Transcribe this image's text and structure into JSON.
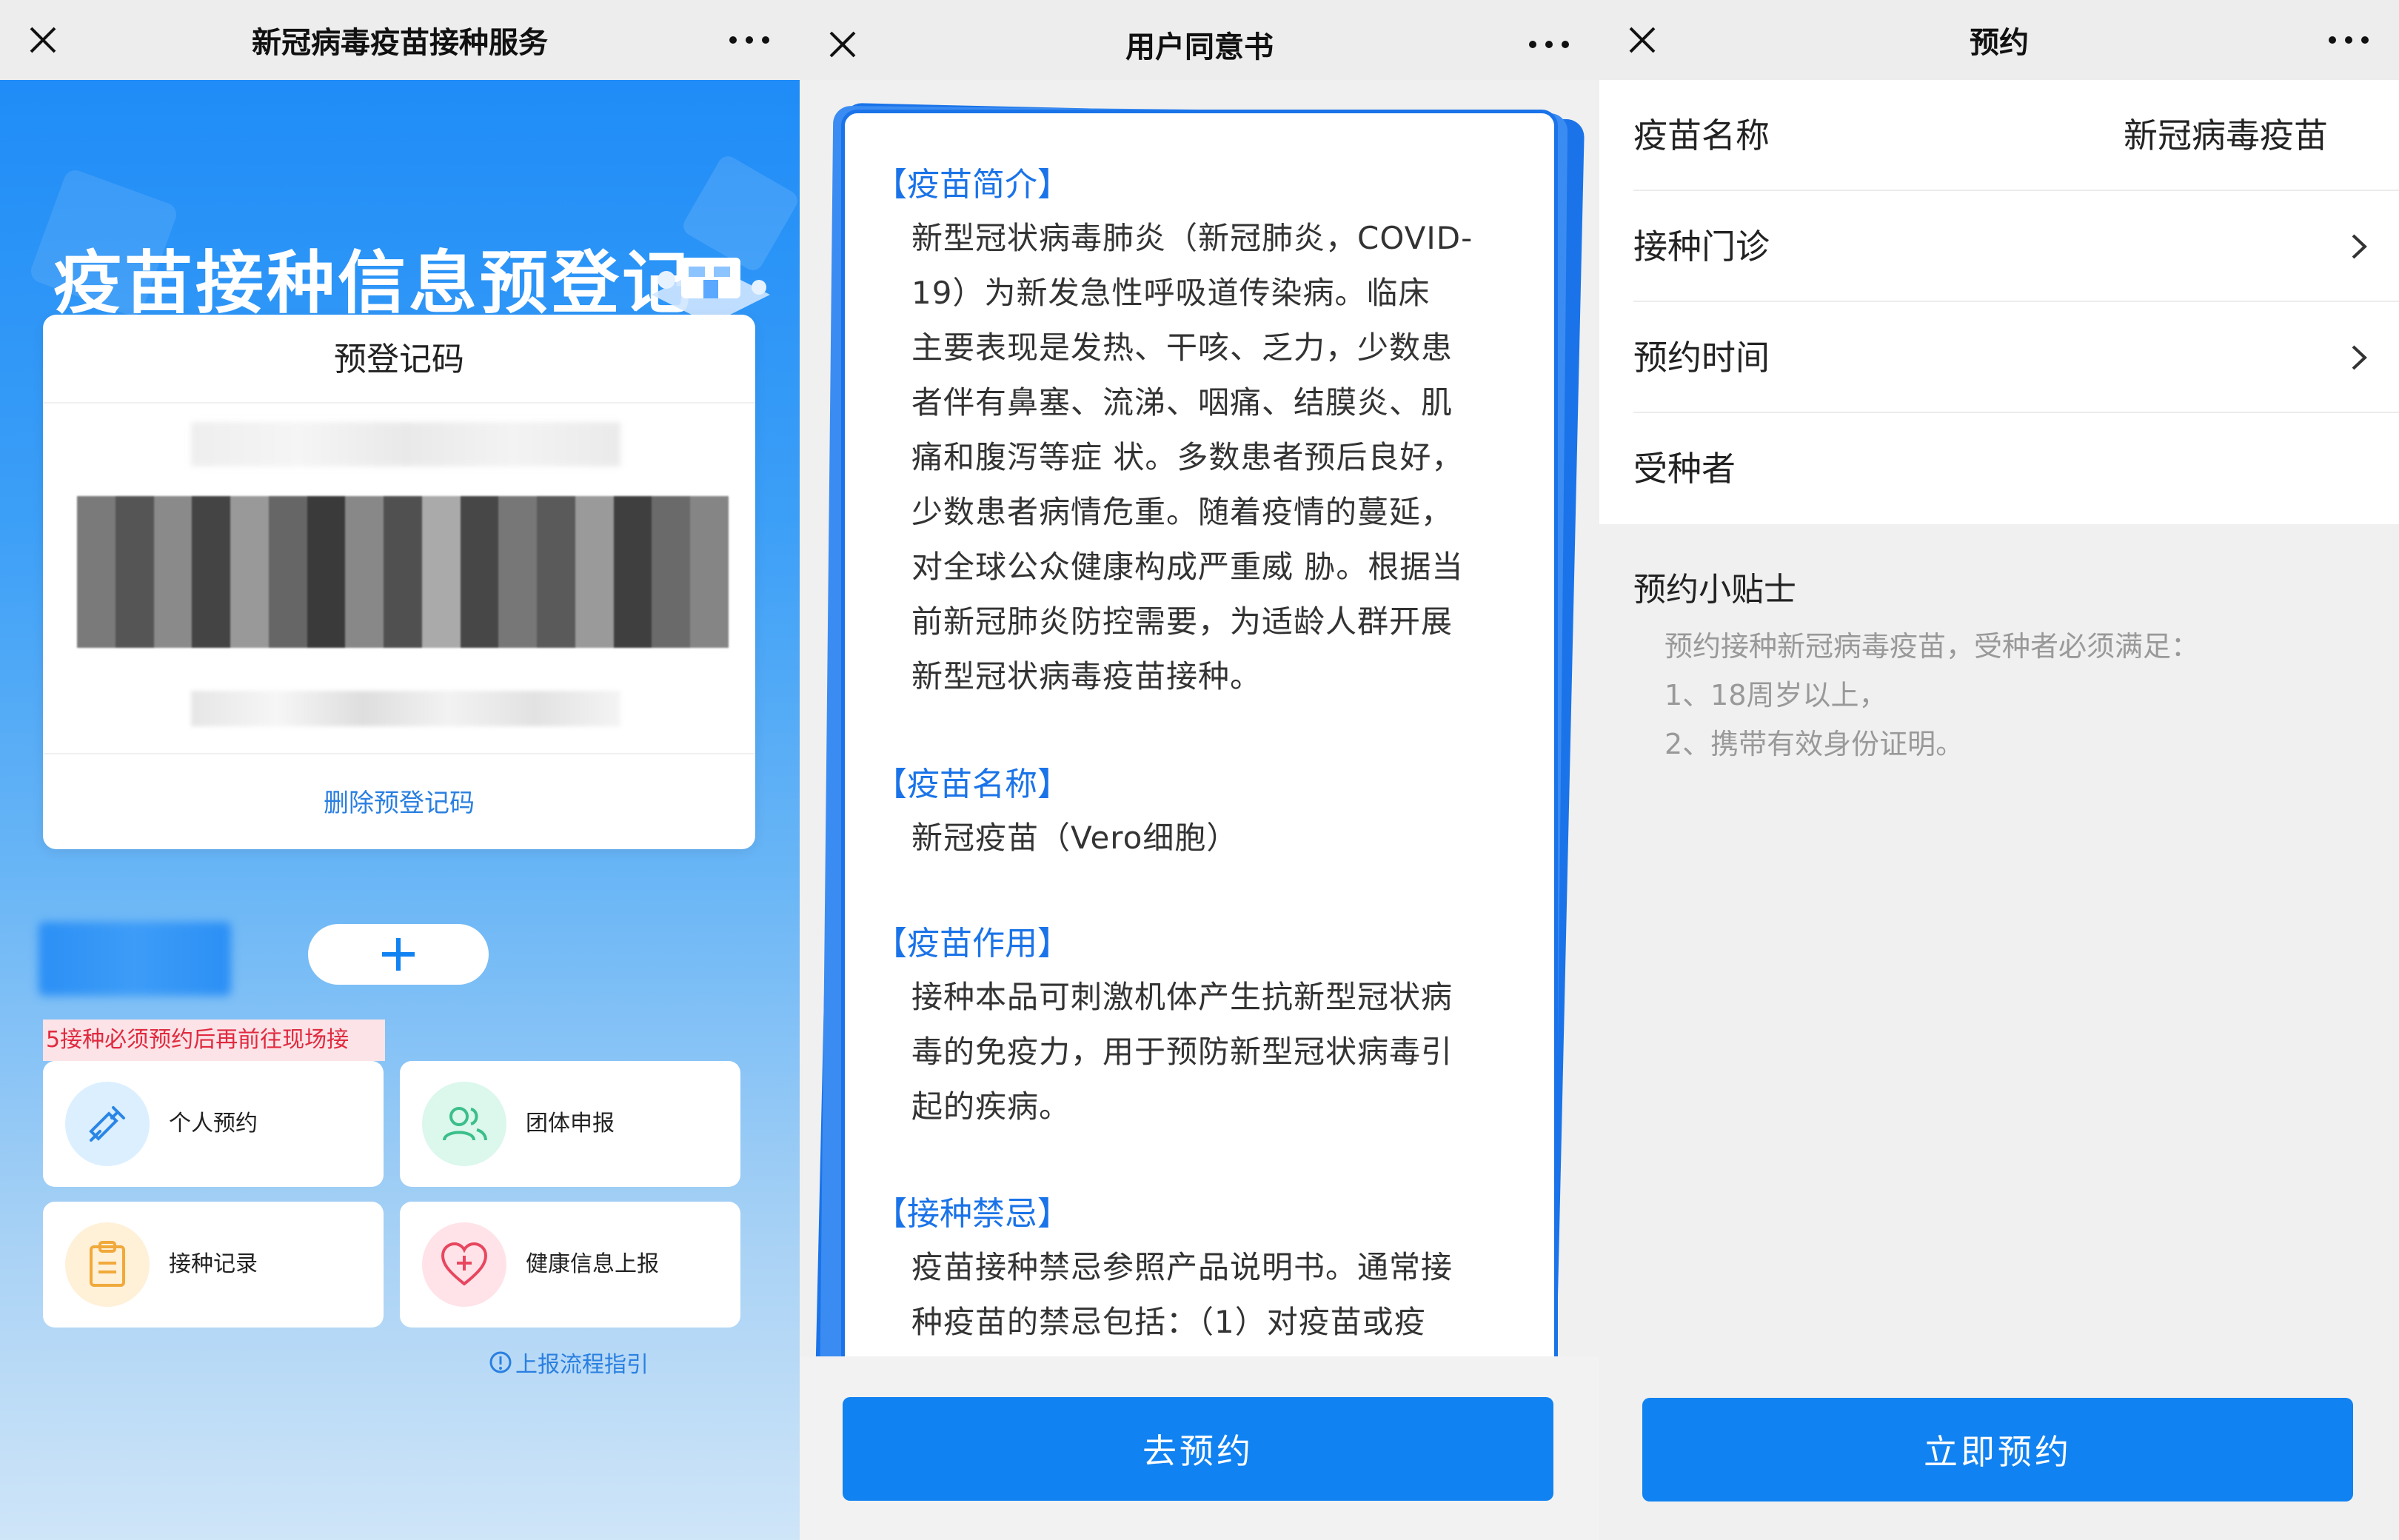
{
  "screen1": {
    "title": "新冠病毒疫苗接种服务",
    "hero_title": "疫苗接种信息预登记",
    "card": {
      "title": "预登记码",
      "delete_label": "删除预登记码"
    },
    "add_label": "+",
    "notice": "5接种必须预约后再前往现场接",
    "tiles": [
      {
        "label": "个人预约",
        "icon": "syringe-icon"
      },
      {
        "label": "团体申报",
        "icon": "group-icon"
      },
      {
        "label": "接种记录",
        "icon": "clipboard-icon"
      },
      {
        "label": "健康信息上报",
        "icon": "heart-plus-icon"
      }
    ],
    "guide_label": "上报流程指引"
  },
  "screen2": {
    "title": "用户同意书",
    "sections": [
      {
        "title": "【疫苗简介】",
        "lines": [
          "新型冠状病毒肺炎（新冠肺炎，COVID-",
          "19）为新发急性呼吸道传染病。临床",
          "主要表现是发热、干咳、乏力，少数患",
          "者伴有鼻塞、流涕、咽痛、结膜炎、肌",
          "痛和腹泻等症 状。多数患者预后良好，",
          "少数患者病情危重。随着疫情的蔓延，",
          "对全球公众健康构成严重威 胁。根据当",
          "前新冠肺炎防控需要，为适龄人群开展",
          "新型冠状病毒疫苗接种。"
        ]
      },
      {
        "title": "【疫苗名称】",
        "lines": [
          "新冠疫苗（Vero细胞）"
        ]
      },
      {
        "title": "【疫苗作用】",
        "lines": [
          "接种本品可刺激机体产生抗新型冠状病",
          "毒的免疫力，用于预防新型冠状病毒引",
          "起的疾病。"
        ]
      },
      {
        "title": "【接种禁忌】",
        "lines": [
          "疫苗接种禁忌参照产品说明书。通常接",
          "种疫苗的禁忌包括：（1）对疫苗或疫"
        ]
      }
    ],
    "button_label": "去预约"
  },
  "screen3": {
    "title": "预约",
    "rows": [
      {
        "label": "疫苗名称",
        "value": "新冠病毒疫苗"
      },
      {
        "label": "接种门诊",
        "value": ""
      },
      {
        "label": "预约时间",
        "value": ""
      },
      {
        "label": "受种者",
        "value": ""
      }
    ],
    "tips_title": "预约小贴士",
    "tips": [
      "预约接种新冠病毒疫苗，受种者必须满足：",
      "1、18周岁以上，",
      "2、携带有效身份证明。"
    ],
    "button_label": "立即预约"
  },
  "colors": {
    "accent": "#1182f1",
    "link": "#2a7fe0",
    "notice_text": "#e02a3f",
    "notice_bg": "#fbe3e7"
  }
}
